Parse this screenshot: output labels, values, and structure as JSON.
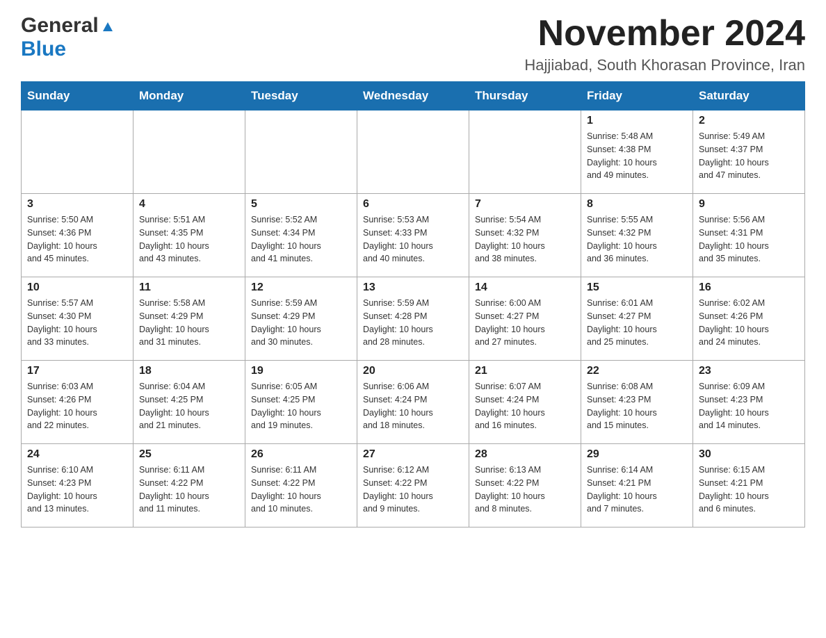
{
  "header": {
    "logo_general": "General",
    "logo_blue": "Blue",
    "month_title": "November 2024",
    "location": "Hajjiabad, South Khorasan Province, Iran"
  },
  "days_of_week": [
    "Sunday",
    "Monday",
    "Tuesday",
    "Wednesday",
    "Thursday",
    "Friday",
    "Saturday"
  ],
  "weeks": [
    {
      "days": [
        {
          "date": "",
          "info": ""
        },
        {
          "date": "",
          "info": ""
        },
        {
          "date": "",
          "info": ""
        },
        {
          "date": "",
          "info": ""
        },
        {
          "date": "",
          "info": ""
        },
        {
          "date": "1",
          "info": "Sunrise: 5:48 AM\nSunset: 4:38 PM\nDaylight: 10 hours\nand 49 minutes."
        },
        {
          "date": "2",
          "info": "Sunrise: 5:49 AM\nSunset: 4:37 PM\nDaylight: 10 hours\nand 47 minutes."
        }
      ]
    },
    {
      "days": [
        {
          "date": "3",
          "info": "Sunrise: 5:50 AM\nSunset: 4:36 PM\nDaylight: 10 hours\nand 45 minutes."
        },
        {
          "date": "4",
          "info": "Sunrise: 5:51 AM\nSunset: 4:35 PM\nDaylight: 10 hours\nand 43 minutes."
        },
        {
          "date": "5",
          "info": "Sunrise: 5:52 AM\nSunset: 4:34 PM\nDaylight: 10 hours\nand 41 minutes."
        },
        {
          "date": "6",
          "info": "Sunrise: 5:53 AM\nSunset: 4:33 PM\nDaylight: 10 hours\nand 40 minutes."
        },
        {
          "date": "7",
          "info": "Sunrise: 5:54 AM\nSunset: 4:32 PM\nDaylight: 10 hours\nand 38 minutes."
        },
        {
          "date": "8",
          "info": "Sunrise: 5:55 AM\nSunset: 4:32 PM\nDaylight: 10 hours\nand 36 minutes."
        },
        {
          "date": "9",
          "info": "Sunrise: 5:56 AM\nSunset: 4:31 PM\nDaylight: 10 hours\nand 35 minutes."
        }
      ]
    },
    {
      "days": [
        {
          "date": "10",
          "info": "Sunrise: 5:57 AM\nSunset: 4:30 PM\nDaylight: 10 hours\nand 33 minutes."
        },
        {
          "date": "11",
          "info": "Sunrise: 5:58 AM\nSunset: 4:29 PM\nDaylight: 10 hours\nand 31 minutes."
        },
        {
          "date": "12",
          "info": "Sunrise: 5:59 AM\nSunset: 4:29 PM\nDaylight: 10 hours\nand 30 minutes."
        },
        {
          "date": "13",
          "info": "Sunrise: 5:59 AM\nSunset: 4:28 PM\nDaylight: 10 hours\nand 28 minutes."
        },
        {
          "date": "14",
          "info": "Sunrise: 6:00 AM\nSunset: 4:27 PM\nDaylight: 10 hours\nand 27 minutes."
        },
        {
          "date": "15",
          "info": "Sunrise: 6:01 AM\nSunset: 4:27 PM\nDaylight: 10 hours\nand 25 minutes."
        },
        {
          "date": "16",
          "info": "Sunrise: 6:02 AM\nSunset: 4:26 PM\nDaylight: 10 hours\nand 24 minutes."
        }
      ]
    },
    {
      "days": [
        {
          "date": "17",
          "info": "Sunrise: 6:03 AM\nSunset: 4:26 PM\nDaylight: 10 hours\nand 22 minutes."
        },
        {
          "date": "18",
          "info": "Sunrise: 6:04 AM\nSunset: 4:25 PM\nDaylight: 10 hours\nand 21 minutes."
        },
        {
          "date": "19",
          "info": "Sunrise: 6:05 AM\nSunset: 4:25 PM\nDaylight: 10 hours\nand 19 minutes."
        },
        {
          "date": "20",
          "info": "Sunrise: 6:06 AM\nSunset: 4:24 PM\nDaylight: 10 hours\nand 18 minutes."
        },
        {
          "date": "21",
          "info": "Sunrise: 6:07 AM\nSunset: 4:24 PM\nDaylight: 10 hours\nand 16 minutes."
        },
        {
          "date": "22",
          "info": "Sunrise: 6:08 AM\nSunset: 4:23 PM\nDaylight: 10 hours\nand 15 minutes."
        },
        {
          "date": "23",
          "info": "Sunrise: 6:09 AM\nSunset: 4:23 PM\nDaylight: 10 hours\nand 14 minutes."
        }
      ]
    },
    {
      "days": [
        {
          "date": "24",
          "info": "Sunrise: 6:10 AM\nSunset: 4:23 PM\nDaylight: 10 hours\nand 13 minutes."
        },
        {
          "date": "25",
          "info": "Sunrise: 6:11 AM\nSunset: 4:22 PM\nDaylight: 10 hours\nand 11 minutes."
        },
        {
          "date": "26",
          "info": "Sunrise: 6:11 AM\nSunset: 4:22 PM\nDaylight: 10 hours\nand 10 minutes."
        },
        {
          "date": "27",
          "info": "Sunrise: 6:12 AM\nSunset: 4:22 PM\nDaylight: 10 hours\nand 9 minutes."
        },
        {
          "date": "28",
          "info": "Sunrise: 6:13 AM\nSunset: 4:22 PM\nDaylight: 10 hours\nand 8 minutes."
        },
        {
          "date": "29",
          "info": "Sunrise: 6:14 AM\nSunset: 4:21 PM\nDaylight: 10 hours\nand 7 minutes."
        },
        {
          "date": "30",
          "info": "Sunrise: 6:15 AM\nSunset: 4:21 PM\nDaylight: 10 hours\nand 6 minutes."
        }
      ]
    }
  ]
}
